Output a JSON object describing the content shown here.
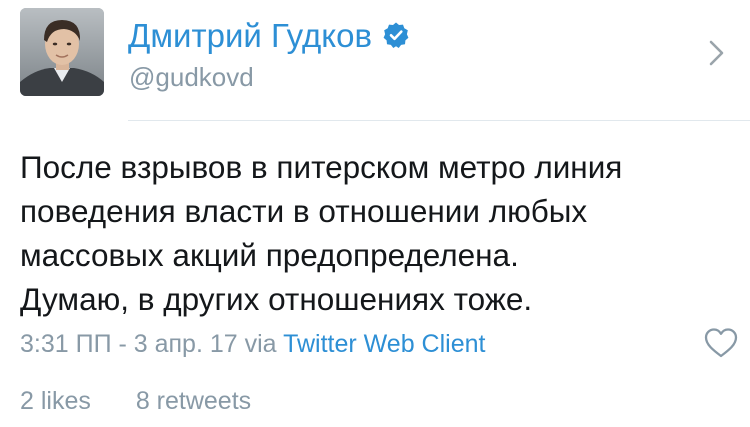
{
  "author": {
    "display_name": "Дмитрий Гудков",
    "handle": "@gudkovd",
    "verified": true
  },
  "tweet": {
    "text_lines": [
      "После взрывов в питерском метро линия",
      "поведения власти в отношении любых",
      "массовых акций предопределена.",
      "Думаю, в других отношениях тоже."
    ],
    "timestamp": "3:31 ПП - 3 апр. 17",
    "via_label": "via",
    "client": "Twitter Web Client"
  },
  "stats": {
    "likes": "2 likes",
    "retweets": "8 retweets"
  },
  "colors": {
    "accent": "#2d8fd5",
    "muted": "#8899a6",
    "text": "#14171a"
  },
  "icons": {
    "verified": "verified-badge-icon",
    "chevron": "chevron-right-icon",
    "like": "heart-outline-icon"
  }
}
